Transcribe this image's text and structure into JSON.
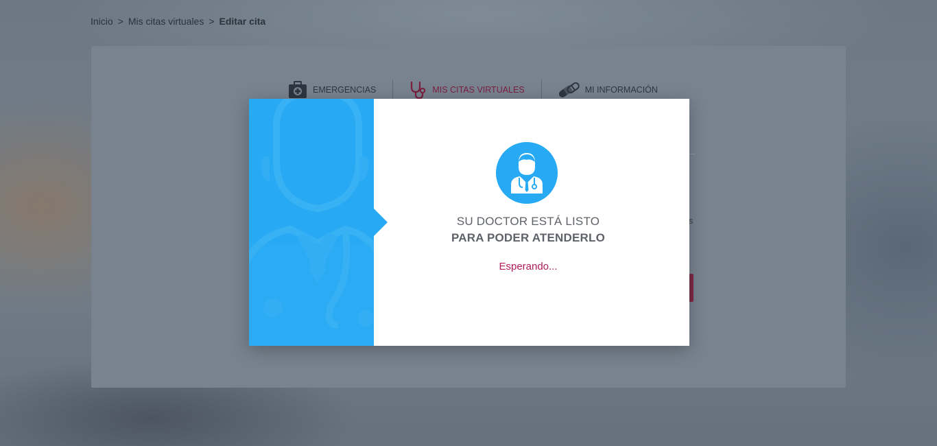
{
  "breadcrumb": {
    "items": [
      "Inicio",
      "Mis citas virtuales"
    ],
    "current": "Editar cita",
    "separator": ">"
  },
  "nav": {
    "tabs": [
      {
        "label": "EMERGENCIAS",
        "icon": "first-aid-kit-icon"
      },
      {
        "label": "MIS CITAS VIRTUALES",
        "icon": "stethoscope-icon",
        "active": true
      },
      {
        "label": "MI INFORMACIÓN",
        "icon": "pills-icon"
      }
    ]
  },
  "background_fragments": {
    "label_colon": ":",
    "text_s": "s"
  },
  "modal": {
    "icon": "doctor-icon",
    "title_line1": "SU DOCTOR ESTÁ LISTO",
    "title_line2": "PARA PODER ATENDERLO",
    "status": "Esperando..."
  },
  "colors": {
    "accent_blue": "#27a9f3",
    "status_magenta": "#b0195a",
    "active_tab": "#7b1f3f"
  }
}
